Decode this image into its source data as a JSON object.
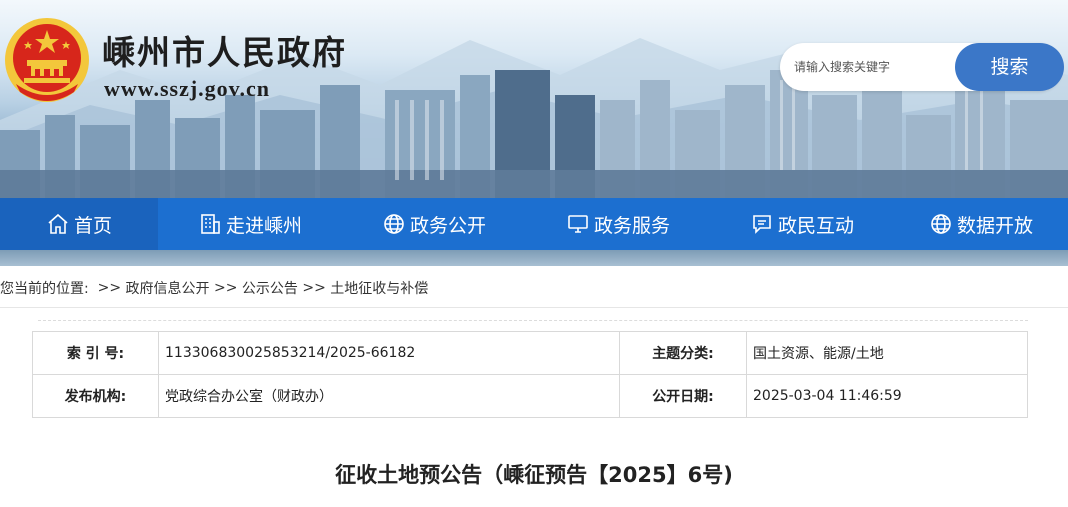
{
  "site": {
    "title": "嵊州市人民政府",
    "url": "www.sszj.gov.cn"
  },
  "search": {
    "placeholder": "请输入搜索关键字",
    "button_label": "搜索"
  },
  "nav": {
    "items": [
      {
        "label": "首页",
        "icon": "home-icon"
      },
      {
        "label": "走进嵊州",
        "icon": "building-icon"
      },
      {
        "label": "政务公开",
        "icon": "globe-icon"
      },
      {
        "label": "政务服务",
        "icon": "monitor-icon"
      },
      {
        "label": "政民互动",
        "icon": "chat-icon"
      },
      {
        "label": "数据开放",
        "icon": "globe-icon"
      }
    ]
  },
  "breadcrumb": {
    "prefix": "您当前的位置:",
    "items": [
      "政府信息公开",
      "公示公告",
      "土地征收与补偿"
    ],
    "separator": " >> "
  },
  "meta": {
    "index_label": "索 引 号:",
    "index_value": "113306830025853214/2025-66182",
    "topic_label": "主题分类:",
    "topic_value": "国土资源、能源/土地",
    "publisher_label": "发布机构:",
    "publisher_value": "党政综合办公室（财政办）",
    "date_label": "公开日期:",
    "date_value": "2025-03-04 11:46:59"
  },
  "document": {
    "title": "征收土地预公告（嵊征预告【2025】6号)"
  },
  "colors": {
    "nav_bg": "#1c6fd0",
    "search_button": "#3b77c8",
    "emblem_red": "#d7261b",
    "emblem_gold": "#f3c73b"
  }
}
